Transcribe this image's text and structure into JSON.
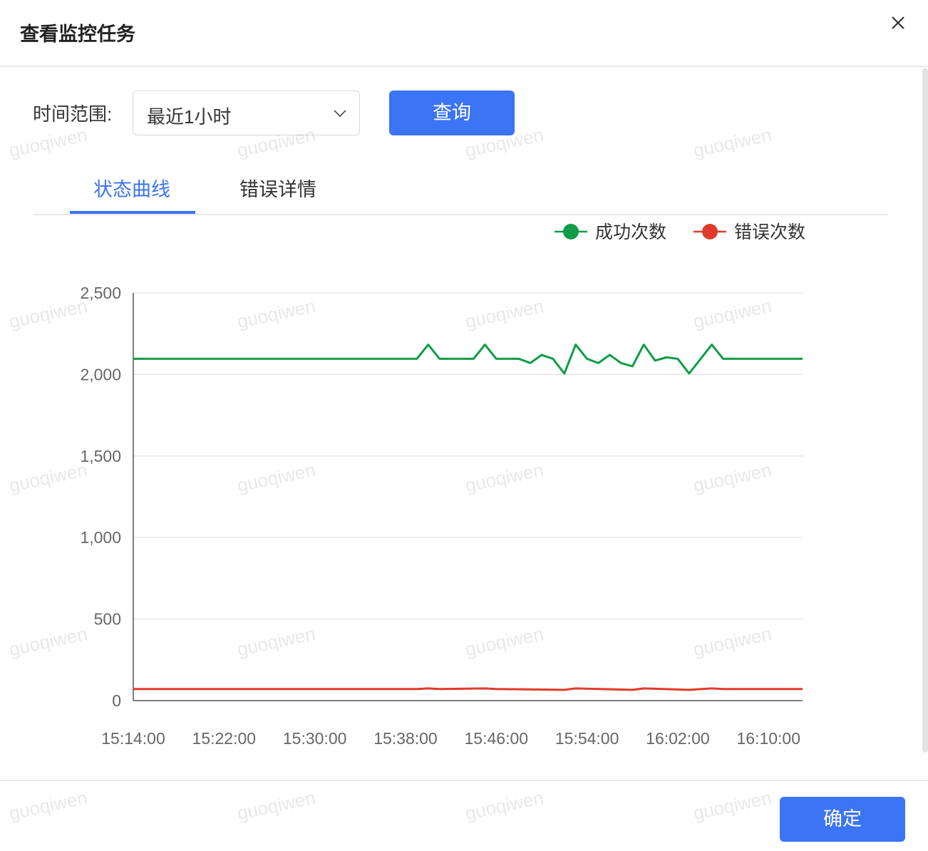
{
  "dialog": {
    "title": "查看监控任务",
    "close_icon": "close-icon"
  },
  "filter": {
    "label": "时间范围:",
    "selected_range": "最近1小时",
    "query_label": "查询"
  },
  "tabs": [
    {
      "label": "状态曲线",
      "active": true
    },
    {
      "label": "错误详情",
      "active": false
    }
  ],
  "footer": {
    "ok_label": "确定"
  },
  "watermark": "guoqiwen",
  "chart_data": {
    "type": "line",
    "title": "",
    "xlabel": "",
    "ylabel": "",
    "ylim": [
      0,
      2500
    ],
    "yticks": [
      "0",
      "500",
      "1,000",
      "1,500",
      "2,000",
      "2,500"
    ],
    "xticks": [
      "15:14:00",
      "15:22:00",
      "15:30:00",
      "15:38:00",
      "15:46:00",
      "15:54:00",
      "16:02:00",
      "16:10:00"
    ],
    "xrange_minutes": [
      0,
      59
    ],
    "grid": true,
    "legend_position": "top-right",
    "series": [
      {
        "name": "成功次数",
        "color": "#0f9d47",
        "points": [
          [
            0,
            2096
          ],
          [
            8,
            2096
          ],
          [
            16,
            2096
          ],
          [
            24,
            2096
          ],
          [
            25,
            2096
          ],
          [
            26,
            2183
          ],
          [
            27,
            2096
          ],
          [
            30,
            2096
          ],
          [
            31,
            2183
          ],
          [
            32,
            2096
          ],
          [
            33,
            2096
          ],
          [
            34,
            2096
          ],
          [
            35,
            2070
          ],
          [
            36,
            2120
          ],
          [
            37,
            2096
          ],
          [
            38,
            2006
          ],
          [
            39,
            2183
          ],
          [
            40,
            2096
          ],
          [
            41,
            2070
          ],
          [
            42,
            2120
          ],
          [
            43,
            2070
          ],
          [
            44,
            2050
          ],
          [
            45,
            2183
          ],
          [
            46,
            2085
          ],
          [
            47,
            2105
          ],
          [
            48,
            2096
          ],
          [
            49,
            2006
          ],
          [
            51,
            2183
          ],
          [
            52,
            2096
          ],
          [
            59,
            2096
          ]
        ]
      },
      {
        "name": "错误次数",
        "color": "#e03a2a",
        "points": [
          [
            0,
            71
          ],
          [
            25,
            71
          ],
          [
            26,
            75
          ],
          [
            27,
            71
          ],
          [
            31,
            75
          ],
          [
            32,
            71
          ],
          [
            38,
            66
          ],
          [
            39,
            75
          ],
          [
            44,
            66
          ],
          [
            45,
            75
          ],
          [
            49,
            66
          ],
          [
            51,
            75
          ],
          [
            52,
            71
          ],
          [
            59,
            71
          ]
        ]
      }
    ]
  }
}
